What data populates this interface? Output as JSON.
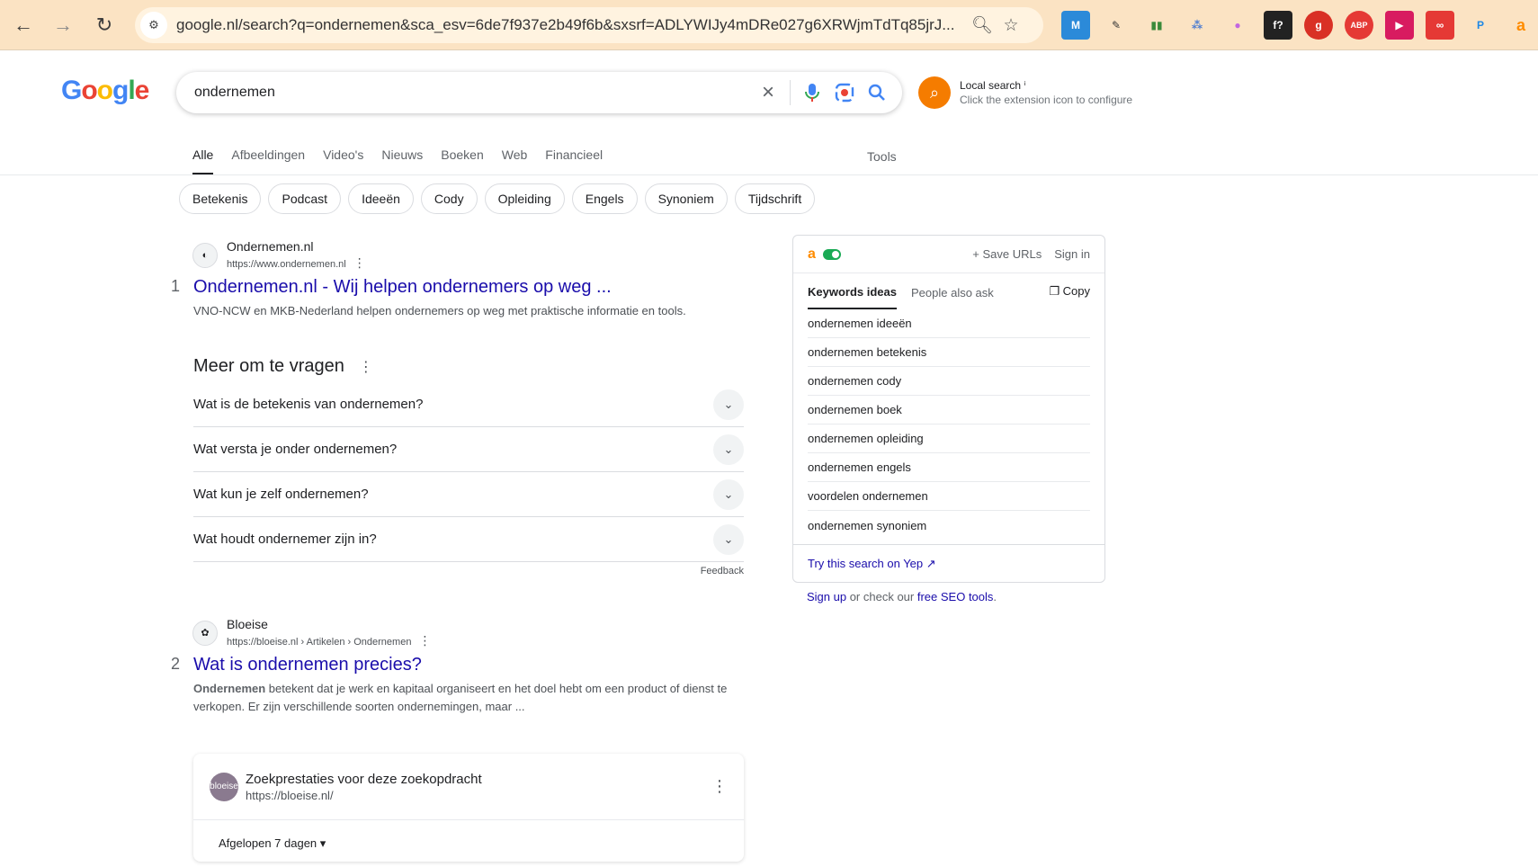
{
  "browser": {
    "url": "google.nl/search?q=ondernemen&sca_esv=6de7f937e2b49f6b&sxsrf=ADLYWIJy4mDRe027g6XRWjmTdTq85jrJ...",
    "extensions": [
      "M",
      "✎",
      "▮▮",
      "⁂",
      "●",
      "f?",
      "g",
      "ABP",
      "▶",
      "∞",
      "P",
      "a"
    ]
  },
  "search": {
    "logo": [
      "G",
      "o",
      "o",
      "g",
      "l",
      "e"
    ],
    "query": "ondernemen"
  },
  "local_search": {
    "title": "Local search ⁱ",
    "subtitle": "Click the extension icon to configure"
  },
  "tabs": [
    "Alle",
    "Afbeeldingen",
    "Video's",
    "Nieuws",
    "Boeken",
    "Web",
    "Financieel"
  ],
  "tools_label": "Tools",
  "chips": [
    "Betekenis",
    "Podcast",
    "Ideeën",
    "Cody",
    "Opleiding",
    "Engels",
    "Synoniem",
    "Tijdschrift"
  ],
  "results": [
    {
      "num": "1",
      "site": "Ondernemen.nl",
      "url": "https://www.ondernemen.nl",
      "title": "Ondernemen.nl - Wij helpen ondernemers op weg ...",
      "snippet": "VNO-NCW en MKB-Nederland helpen ondernemers op weg met praktische informatie en tools."
    },
    {
      "num": "2",
      "site": "Bloeise",
      "url": "https://bloeise.nl › Artikelen › Ondernemen",
      "title": "Wat is ondernemen precies?",
      "snippet_bold": "Ondernemen",
      "snippet": " betekent dat je werk en kapitaal organiseert en het doel hebt om een product of dienst te verkopen. Er zijn verschillende soorten ondernemingen, maar ..."
    }
  ],
  "paa": {
    "title": "Meer om te vragen",
    "questions": [
      "Wat is de betekenis van ondernemen?",
      "Wat versta je onder ondernemen?",
      "Wat kun je zelf ondernemen?",
      "Wat houdt ondernemer zijn in?"
    ],
    "feedback": "Feedback"
  },
  "performance": {
    "avatar": "bloeise",
    "title": "Zoekprestaties voor deze zoekopdracht",
    "url": "https://bloeise.nl/",
    "period": "Afgelopen 7 dagen"
  },
  "panel": {
    "save_urls": "+ Save URLs",
    "sign_in": "Sign in",
    "tab_keywords": "Keywords ideas",
    "tab_paa": "People also ask",
    "copy": "Copy",
    "keywords": [
      "ondernemen ideeën",
      "ondernemen betekenis",
      "ondernemen cody",
      "ondernemen boek",
      "ondernemen opleiding",
      "ondernemen engels",
      "voordelen ondernemen",
      "ondernemen synoniem"
    ],
    "footer": "Try this search on Yep ↗",
    "below_signup": "Sign up",
    "below_mid": " or check our ",
    "below_link": "free SEO tools",
    "below_end": "."
  }
}
